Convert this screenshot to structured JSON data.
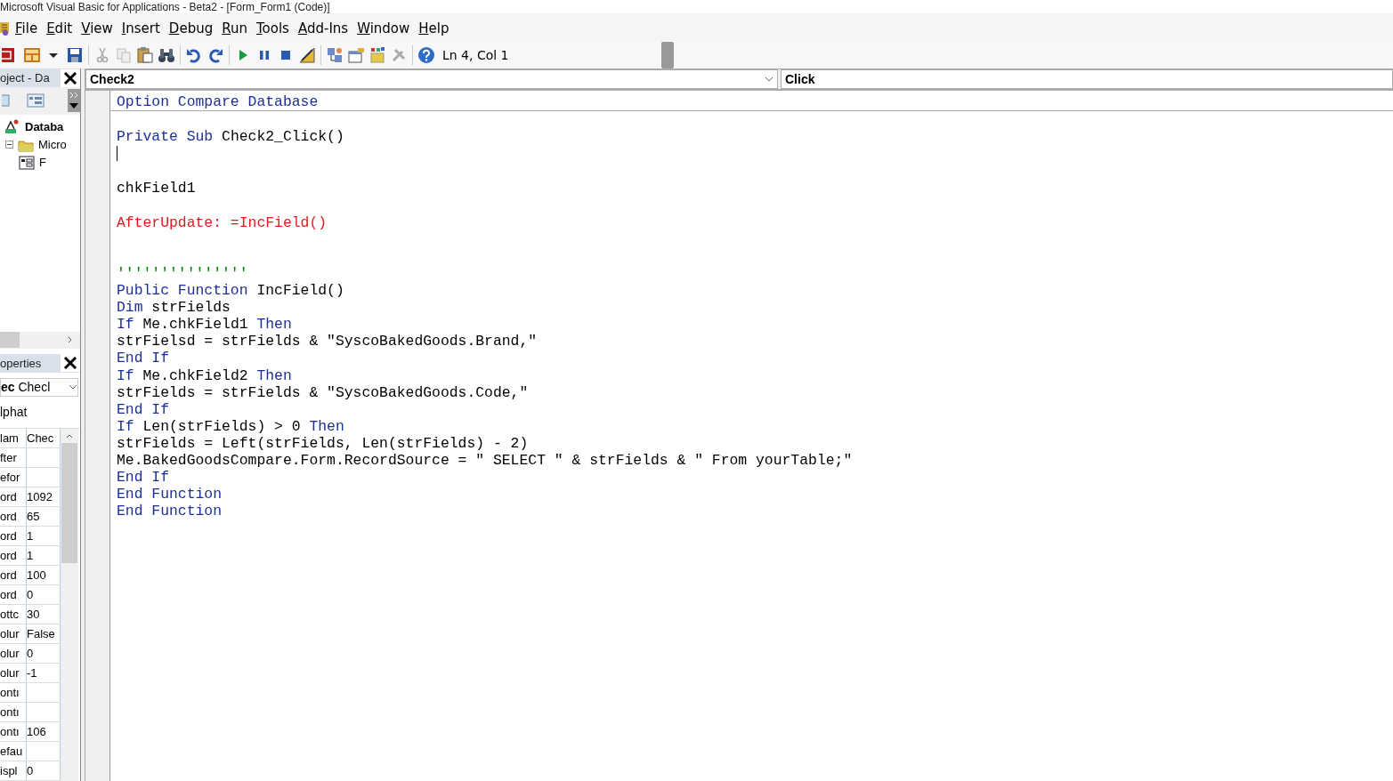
{
  "window": {
    "title": "Microsoft Visual Basic for Applications - Beta2 - [Form_Form1 (Code)]"
  },
  "menu": [
    "File",
    "Edit",
    "View",
    "Insert",
    "Debug",
    "Run",
    "Tools",
    "Add-Ins",
    "Window",
    "Help"
  ],
  "toolbar": {
    "position": "Ln 4, Col 1"
  },
  "project": {
    "title": "oject - Da",
    "tree": [
      {
        "label": "Databa",
        "expanded": true,
        "children": [
          {
            "label": "Micro",
            "expanded": true,
            "children": [
              {
                "label": "F"
              }
            ]
          }
        ]
      }
    ]
  },
  "properties": {
    "title": "operties",
    "object": {
      "name": "ec",
      "type": "Checl"
    },
    "tab": "lphat",
    "header": {
      "name": "lam",
      "value": "Chec"
    },
    "rows": [
      {
        "name": "fter"
      },
      {
        "name": "efor"
      },
      {
        "name": "ord",
        "value": "1092"
      },
      {
        "name": "ord",
        "value": "65"
      },
      {
        "name": "ord",
        "value": "1"
      },
      {
        "name": "ord",
        "value": "1"
      },
      {
        "name": "ord",
        "value": "100"
      },
      {
        "name": "ord",
        "value": "0"
      },
      {
        "name": "ottc",
        "value": "30"
      },
      {
        "name": "olur",
        "value": "False"
      },
      {
        "name": "olur",
        "value": "0"
      },
      {
        "name": "olur",
        "value": "-1"
      },
      {
        "name": "ontı"
      },
      {
        "name": "ontı"
      },
      {
        "name": "ontı",
        "value": "106"
      },
      {
        "name": "efau"
      },
      {
        "name": "ispl",
        "value": "0"
      }
    ]
  },
  "code": {
    "object": "Check2",
    "procedure": "Click",
    "declarations": [
      {
        "kind": "code",
        "segments": [
          {
            "text": "Option Compare Database",
            "kind": "keyword"
          }
        ]
      }
    ],
    "lines": [
      {
        "kind": "blank"
      },
      {
        "kind": "code",
        "segments": [
          {
            "text": "Private Sub ",
            "kind": "keyword"
          },
          {
            "text": "Check2_Click()",
            "kind": "plain"
          }
        ]
      },
      {
        "kind": "cursor"
      },
      {
        "kind": "blank"
      },
      {
        "kind": "code",
        "segments": [
          {
            "text": "chkField1",
            "kind": "plain"
          }
        ]
      },
      {
        "kind": "blank"
      },
      {
        "kind": "code",
        "segments": [
          {
            "text": "AfterUpdate: =IncField()",
            "kind": "error"
          }
        ]
      },
      {
        "kind": "blank"
      },
      {
        "kind": "blank"
      },
      {
        "kind": "code",
        "segments": [
          {
            "text": "'''''''''''''''",
            "kind": "comment"
          }
        ]
      },
      {
        "kind": "code",
        "segments": [
          {
            "text": "Public Function ",
            "kind": "keyword"
          },
          {
            "text": "IncField()",
            "kind": "plain"
          }
        ]
      },
      {
        "kind": "code",
        "segments": [
          {
            "text": "Dim ",
            "kind": "keyword"
          },
          {
            "text": "strFields",
            "kind": "plain"
          }
        ]
      },
      {
        "kind": "code",
        "segments": [
          {
            "text": "If ",
            "kind": "keyword"
          },
          {
            "text": "Me.chkField1 ",
            "kind": "plain"
          },
          {
            "text": "Then",
            "kind": "keyword"
          }
        ]
      },
      {
        "kind": "code",
        "segments": [
          {
            "text": "strFielsd = strFields & \"SyscoBakedGoods.Brand,\"",
            "kind": "plain"
          }
        ]
      },
      {
        "kind": "code",
        "segments": [
          {
            "text": "End If",
            "kind": "keyword"
          }
        ]
      },
      {
        "kind": "code",
        "segments": [
          {
            "text": "If ",
            "kind": "keyword"
          },
          {
            "text": "Me.chkField2 ",
            "kind": "plain"
          },
          {
            "text": "Then",
            "kind": "keyword"
          }
        ]
      },
      {
        "kind": "code",
        "segments": [
          {
            "text": "strFields = strFields & \"SyscoBakedGoods.Code,\"",
            "kind": "plain"
          }
        ]
      },
      {
        "kind": "code",
        "segments": [
          {
            "text": "End If",
            "kind": "keyword"
          }
        ]
      },
      {
        "kind": "code",
        "segments": [
          {
            "text": "If ",
            "kind": "keyword"
          },
          {
            "text": "Len(strFields) > 0 ",
            "kind": "plain"
          },
          {
            "text": "Then",
            "kind": "keyword"
          }
        ]
      },
      {
        "kind": "code",
        "segments": [
          {
            "text": "strFields = Left(strFields, Len(strFields) - 2)",
            "kind": "plain"
          }
        ]
      },
      {
        "kind": "code",
        "segments": [
          {
            "text": "Me.BakedGoodsCompare.Form.RecordSource = \" SELECT \" & strFields & \" From yourTable;\"",
            "kind": "plain"
          }
        ]
      },
      {
        "kind": "code",
        "segments": [
          {
            "text": "End If",
            "kind": "keyword"
          }
        ]
      },
      {
        "kind": "code",
        "segments": [
          {
            "text": "End Function",
            "kind": "keyword"
          }
        ]
      },
      {
        "kind": "code",
        "segments": [
          {
            "text": "End Function",
            "kind": "keyword"
          }
        ]
      }
    ]
  }
}
